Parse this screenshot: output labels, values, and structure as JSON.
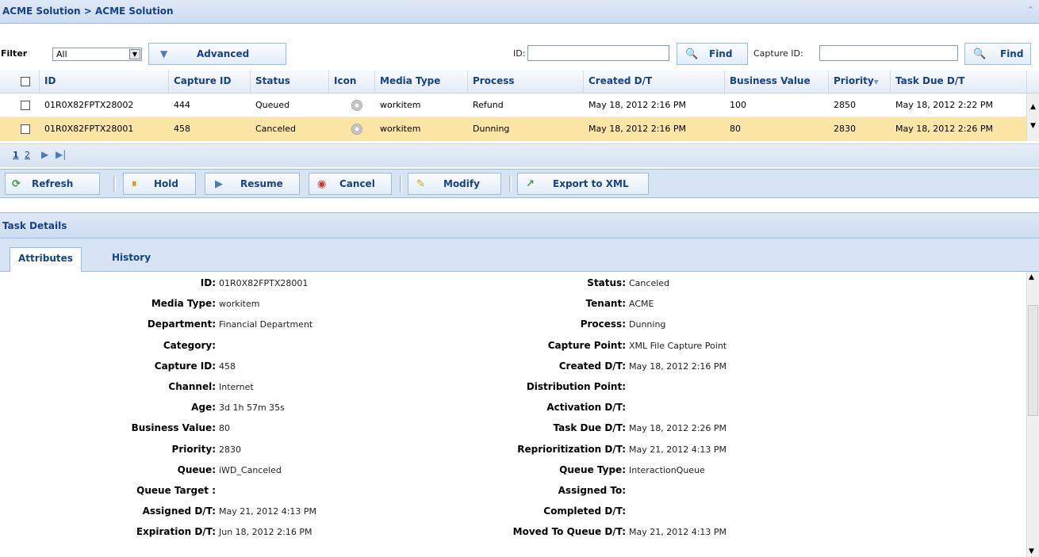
{
  "title": "ACME Solution > ACME Solution",
  "filter": {
    "label": "Filter",
    "value": "All",
    "advanced_label": "Advanced",
    "id_label": "ID:",
    "id_value": "",
    "find_label": "Find",
    "capture_id_label": "Capture ID:",
    "capture_id_value": "",
    "find2_label": "Find"
  },
  "grid": {
    "columns": [
      "ID",
      "Capture ID",
      "Status",
      "Icon",
      "Media Type",
      "Process",
      "Created D/T",
      "Business Value",
      "Priority",
      "Task Due D/T"
    ],
    "rows": [
      {
        "id": "01R0X82FPTX28002",
        "capture_id": "444",
        "status": "Queued",
        "icon": "gear-icon",
        "media_type": "workitem",
        "process": "Refund",
        "created": "May 18, 2012 2:16 PM",
        "business_value": "100",
        "priority": "2850",
        "task_due": "May 18, 2012 2:22 PM"
      },
      {
        "id": "01R0X82FPTX28001",
        "capture_id": "458",
        "status": "Canceled",
        "icon": "gear-icon",
        "media_type": "workitem",
        "process": "Dunning",
        "created": "May 18, 2012 2:16 PM",
        "business_value": "80",
        "priority": "2830",
        "task_due": "May 18, 2012 2:26 PM"
      }
    ],
    "selected_row_color": "#fbe6a5"
  },
  "pager": {
    "page1": "1",
    "page2": "2"
  },
  "toolbar": {
    "refresh": "Refresh",
    "hold": "Hold",
    "resume": "Resume",
    "cancel": "Cancel",
    "modify": "Modify",
    "export": "Export to XML"
  },
  "details": {
    "title": "Task Details",
    "tabs": [
      "Attributes",
      "History"
    ],
    "left": [
      {
        "label": "ID:",
        "value": "01R0X82FPTX28001"
      },
      {
        "label": "Media Type:",
        "value": "workitem"
      },
      {
        "label": "Department:",
        "value": "Financial Department"
      },
      {
        "label": "Category:",
        "value": ""
      },
      {
        "label": "Capture ID:",
        "value": "458"
      },
      {
        "label": "Channel:",
        "value": "Internet"
      },
      {
        "label": "Age:",
        "value": "3d 1h 57m 35s"
      },
      {
        "label": "Business Value:",
        "value": "80"
      },
      {
        "label": "Priority:",
        "value": "2830"
      },
      {
        "label": "Queue:",
        "value": "iWD_Canceled"
      },
      {
        "label": "Queue Target :",
        "value": ""
      },
      {
        "label": "Assigned D/T:",
        "value": "May 21, 2012 4:13 PM"
      },
      {
        "label": "Expiration D/T:",
        "value": "Jun 18, 2012 2:16 PM"
      }
    ],
    "right": [
      {
        "label": "Status:",
        "value": "Canceled"
      },
      {
        "label": "Tenant:",
        "value": "ACME"
      },
      {
        "label": "Process:",
        "value": "Dunning"
      },
      {
        "label": "Capture Point:",
        "value": "XML File Capture Point"
      },
      {
        "label": "Created D/T:",
        "value": "May 18, 2012 2:16 PM"
      },
      {
        "label": "Distribution Point:",
        "value": ""
      },
      {
        "label": "Activation D/T:",
        "value": ""
      },
      {
        "label": "Task Due D/T:",
        "value": "May 18, 2012 2:26 PM"
      },
      {
        "label": "Reprioritization D/T:",
        "value": "May 21, 2012 4:13 PM"
      },
      {
        "label": "Queue Type:",
        "value": "InteractionQueue"
      },
      {
        "label": "Assigned To:",
        "value": ""
      },
      {
        "label": "Completed D/T:",
        "value": ""
      },
      {
        "label": "Moved To Queue D/T:",
        "value": "May 21, 2012 4:13 PM"
      }
    ]
  }
}
